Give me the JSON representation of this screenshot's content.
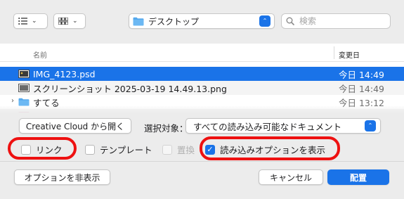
{
  "toolbar": {
    "view_list_icon": "list-icon",
    "view_grid_icon": "grid-icon",
    "location": {
      "label": "デスクトップ",
      "icon": "folder-icon"
    },
    "search": {
      "placeholder": "検索",
      "value": ""
    }
  },
  "file_list": {
    "columns": {
      "name": "名前",
      "date": "変更日"
    },
    "rows": [
      {
        "name": "IMG_4123.psd",
        "date": "今日 14:49",
        "selected": true,
        "icon": "image-file-icon"
      },
      {
        "name": "スクリーンショット 2025-03-19 14.49.13.png",
        "date": "今日 14:49",
        "selected": false,
        "icon": "image-file-icon"
      },
      {
        "name": "すてる",
        "date": "今日 13:12",
        "selected": false,
        "icon": "folder-icon"
      }
    ]
  },
  "options": {
    "creative_cloud_button": "Creative Cloud から開く",
    "filter_label": "選択対象：",
    "filter_value": "すべての読み込み可能なドキュメント",
    "link_label": "リンク",
    "link_checked": false,
    "template_label": "テンプレート",
    "template_checked": false,
    "replace_label": "置換",
    "replace_checked": false,
    "replace_enabled": false,
    "show_import_options_label": "読み込みオプションを表示",
    "show_import_options_checked": true
  },
  "footer": {
    "hide_options_button": "オプションを非表示",
    "cancel_button": "キャンセル",
    "place_button": "配置"
  },
  "colors": {
    "accent": "#1a73e8",
    "annotation": "#ee1111"
  }
}
